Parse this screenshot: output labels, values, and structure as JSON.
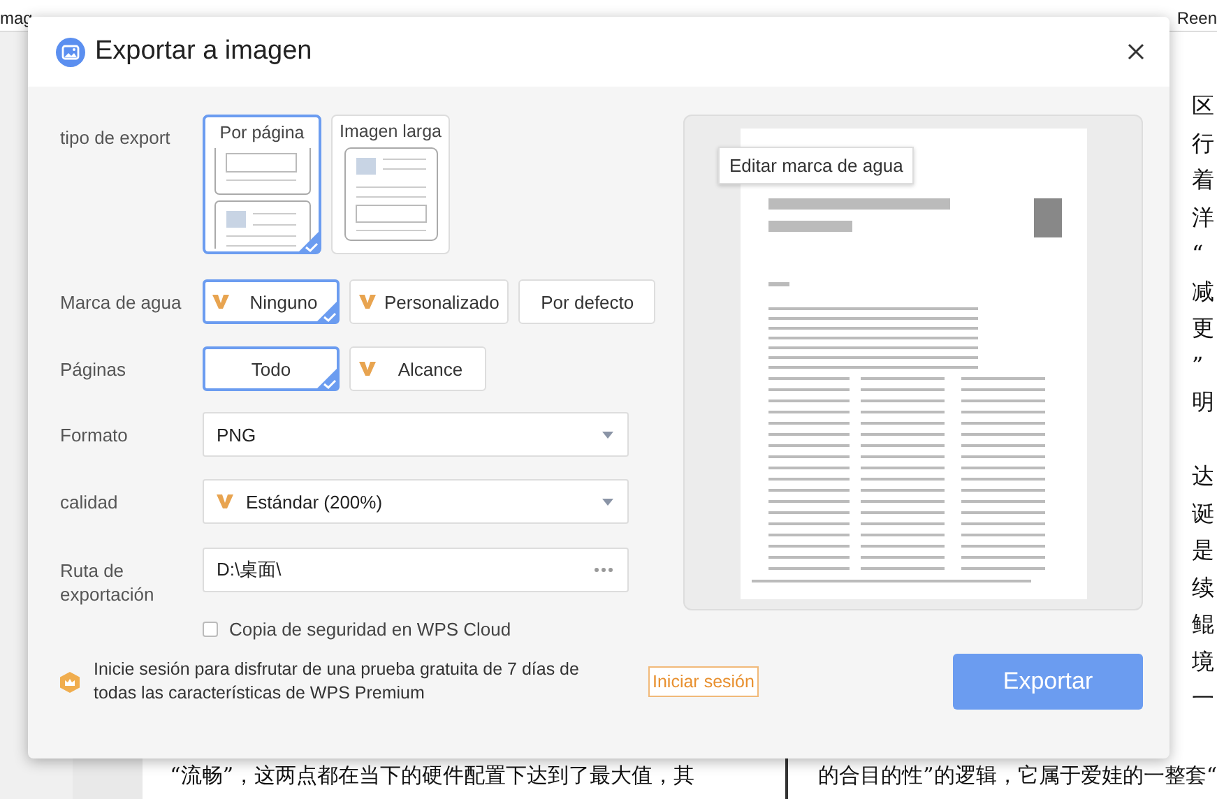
{
  "toolbar": {
    "left_label": "mag",
    "right_label": "Reen"
  },
  "document": {
    "side_char_groups": [
      [
        "区",
        "行",
        "着",
        "洋",
        "“",
        "减",
        "更",
        "”",
        "明"
      ],
      [
        "达",
        "诞",
        "是",
        "续",
        "鲲",
        "境",
        "一"
      ]
    ],
    "bottom_lines": [
      "“流畅”，这两点都在当下的硬件配置下达到了最大值，其",
      "的合目的性”的逻辑，它属于爱娃的一整套“"
    ]
  },
  "dialog": {
    "title": "Exportar a imagen",
    "export_type": {
      "label": "tipo de export",
      "options": [
        {
          "label": "Por página",
          "kind": "pages",
          "selected": true
        },
        {
          "label": "Imagen larga",
          "kind": "long",
          "selected": false
        }
      ]
    },
    "watermark": {
      "label": "Marca de agua",
      "options": [
        {
          "label": "Ninguno",
          "premium": true,
          "selected": true
        },
        {
          "label": "Personalizado",
          "premium": true,
          "selected": false
        },
        {
          "label": "Por defecto",
          "premium": false,
          "selected": false
        }
      ]
    },
    "pages": {
      "label": "Páginas",
      "options": [
        {
          "label": "Todo",
          "premium": false,
          "selected": true
        },
        {
          "label": "Alcance",
          "premium": true,
          "selected": false
        }
      ]
    },
    "format": {
      "label": "Formato",
      "value": "PNG",
      "premium": false
    },
    "quality": {
      "label": "calidad",
      "value": "Estándar (200%)",
      "premium": true
    },
    "path": {
      "label": "Ruta de exportación",
      "value": "D:\\桌面\\"
    },
    "cloud_backup": {
      "label": "Copia de seguridad en WPS Cloud",
      "checked": false
    },
    "promo": {
      "text": "Inicie sesión para disfrutar de una prueba gratuita de 7 días de todas las características de WPS Premium",
      "link": "Iniciar sesión"
    },
    "export_button": "Exportar",
    "preview": {
      "tooltip": "Editar marca de agua"
    }
  }
}
